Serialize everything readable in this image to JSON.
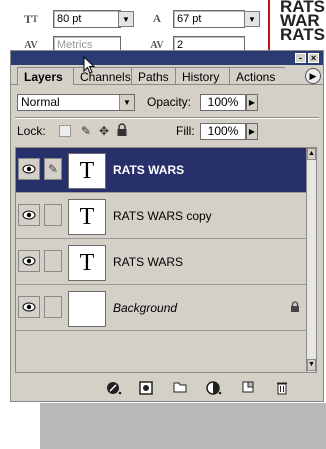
{
  "character_panel": {
    "font_size": "80 pt",
    "leading": "67 pt",
    "kerning": "Metrics",
    "tracking": "2",
    "preview_text": "RATS\nWAR\nRATS"
  },
  "layers_panel": {
    "tabs": [
      "Layers",
      "Channels",
      "Paths",
      "History",
      "Actions"
    ],
    "active_tab": "Layers",
    "blend_mode": "Normal",
    "opacity_label": "Opacity:",
    "opacity_value": "100%",
    "lock_label": "Lock:",
    "fill_label": "Fill:",
    "fill_value": "100%",
    "layers": [
      {
        "name": "RATS WARS",
        "type": "text",
        "visible": true,
        "selected": true
      },
      {
        "name": "RATS WARS copy",
        "type": "text",
        "visible": true,
        "selected": false
      },
      {
        "name": "RATS WARS",
        "type": "text",
        "visible": true,
        "selected": false
      },
      {
        "name": "Background",
        "type": "background",
        "visible": true,
        "selected": false,
        "locked": true
      }
    ],
    "thumb_glyph": "T"
  },
  "colors": {
    "titlebar": "#2b3c74",
    "selected_row": "#27306a",
    "panel_bg": "#d4d0c8"
  },
  "icons": {
    "eye": "eye-icon",
    "brush": "brush-icon",
    "lock": "lock-icon",
    "footer": [
      "layer-style-icon",
      "mask-icon",
      "folder-icon",
      "adjustment-icon",
      "new-layer-icon",
      "trash-icon"
    ]
  }
}
